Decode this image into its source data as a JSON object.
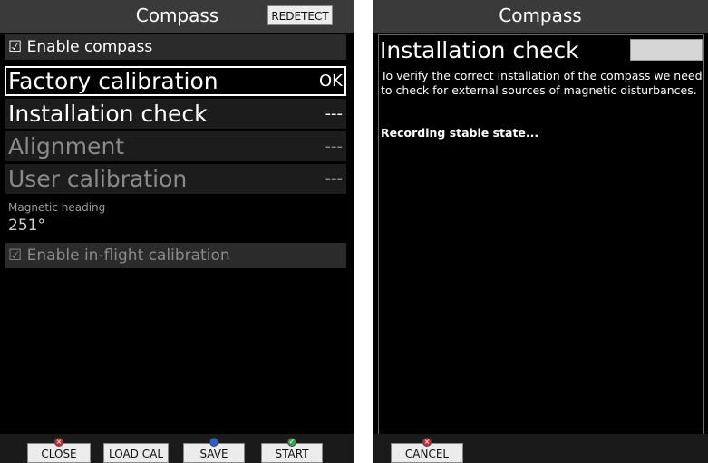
{
  "left": {
    "title": "Compass",
    "redetect_label": "REDETECT",
    "enable_compass": "☑ Enable compass",
    "menu": [
      {
        "label": "Factory calibration",
        "status": "OK"
      },
      {
        "label": "Installation check",
        "status": "---"
      },
      {
        "label": "Alignment",
        "status": "---"
      },
      {
        "label": "User calibration",
        "status": "---"
      }
    ],
    "heading_label": "Magnetic heading",
    "heading_value": "251°",
    "enable_inflight": "☑ Enable in-flight calibration",
    "softkeys": {
      "close": "CLOSE",
      "load_cal": "LOAD CAL",
      "save": "SAVE",
      "start": "START"
    }
  },
  "right": {
    "title": "Compass",
    "installation_title": "Installation check",
    "description": "To verify the correct installation of the compass we need to check for external sources of magnetic disturbances.",
    "status": "Recording stable state...",
    "cancel_label": "CANCEL"
  },
  "colors": {
    "background": "#000000",
    "accent_red": "#d62b2b",
    "accent_blue": "#2b5fd6",
    "accent_green": "#2fa84a"
  }
}
